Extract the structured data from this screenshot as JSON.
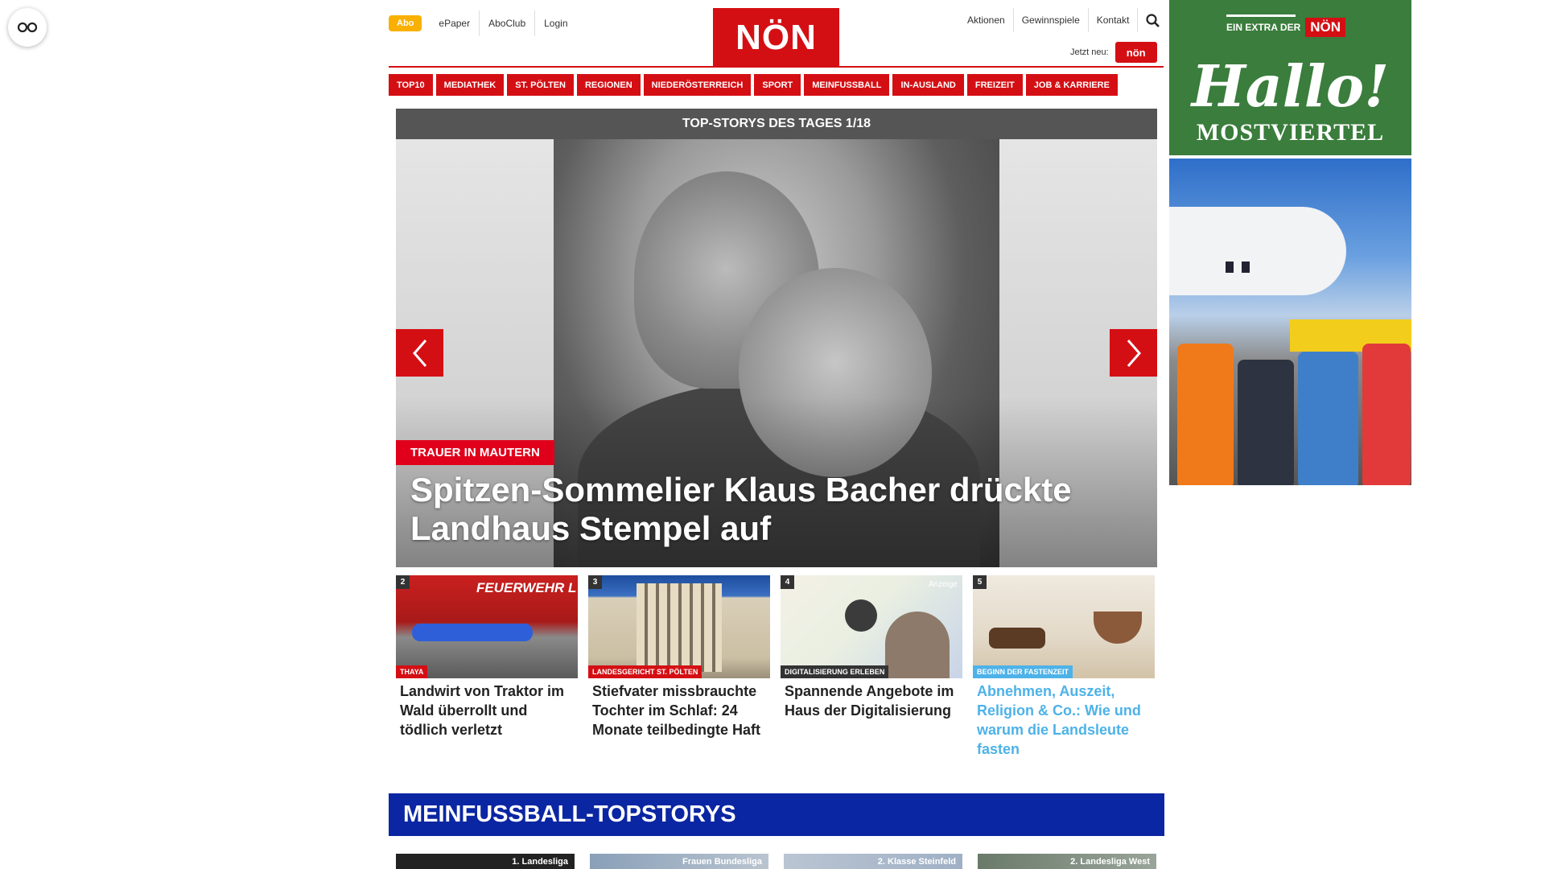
{
  "header": {
    "abo": "Abo",
    "left_links": [
      "ePaper",
      "AboClub",
      "Login"
    ],
    "logo": "NÖN",
    "right_links": [
      "Aktionen",
      "Gewinnspiele",
      "Kontakt"
    ],
    "jetzt_neu": "Jetzt neu:",
    "jetzt_badge": "nön"
  },
  "nav": [
    "TOP10",
    "MEDIATHEK",
    "ST. PÖLTEN",
    "REGIONEN",
    "NIEDERÖSTERREICH",
    "SPORT",
    "MEINFUSSBALL",
    "IN-AUSLAND",
    "FREIZEIT",
    "JOB & KARRIERE"
  ],
  "topstories": {
    "title": "TOP-STORYS DES TAGES 1/18",
    "hero": {
      "tag": "TRAUER IN MAUTERN",
      "title": "Spitzen-Sommelier Klaus Bacher drückte Landhaus Stempel auf"
    },
    "cards": [
      {
        "num": "2",
        "tag": "THAYA",
        "title": "Landwirt von Traktor im Wald überrollt und tödlich verletzt",
        "tag_color": "#d40f14",
        "title_color": "#222222"
      },
      {
        "num": "3",
        "tag": "LANDESGERICHT ST. PÖLTEN",
        "title": "Stiefvater missbrauchte Tochter im Schlaf: 24 Monate teilbedingte Haft",
        "tag_color": "#d40f14",
        "title_color": "#222222"
      },
      {
        "num": "4",
        "tag": "DIGITALISIERUNG ERLEBEN",
        "title": "Spannende Angebote im Haus der Digitalisierung",
        "anzeige": "Anzeige",
        "tag_color": "#333333",
        "title_color": "#222222"
      },
      {
        "num": "5",
        "tag": "BEGINN DER FASTENZEIT",
        "title": "Abnehmen, Auszeit, Religion & Co.: Wie und warum die Landsleute fasten",
        "tag_color": "#4db2e8",
        "title_color": "#4db2e8"
      }
    ]
  },
  "meinfussball": {
    "title": "MEINFUSSBALL-TOPSTORYS",
    "thumbs": [
      "1. Landesliga",
      "Frauen Bundesliga",
      "2. Klasse Steinfeld",
      "2. Landesliga West"
    ]
  },
  "ad": {
    "extra": "EIN EXTRA DER",
    "extra_brand": "NÖN",
    "hallo": "Hallo!",
    "region": "MOSTVIERTEL"
  },
  "colors": {
    "brand_red": "#d40f14",
    "abo_yellow": "#f9b000",
    "fussball_blue": "#0b26a2",
    "ad_green": "#3a7d3c"
  },
  "icons": [
    "glasses-icon",
    "search-icon",
    "chevron-left-icon",
    "chevron-right-icon"
  ]
}
